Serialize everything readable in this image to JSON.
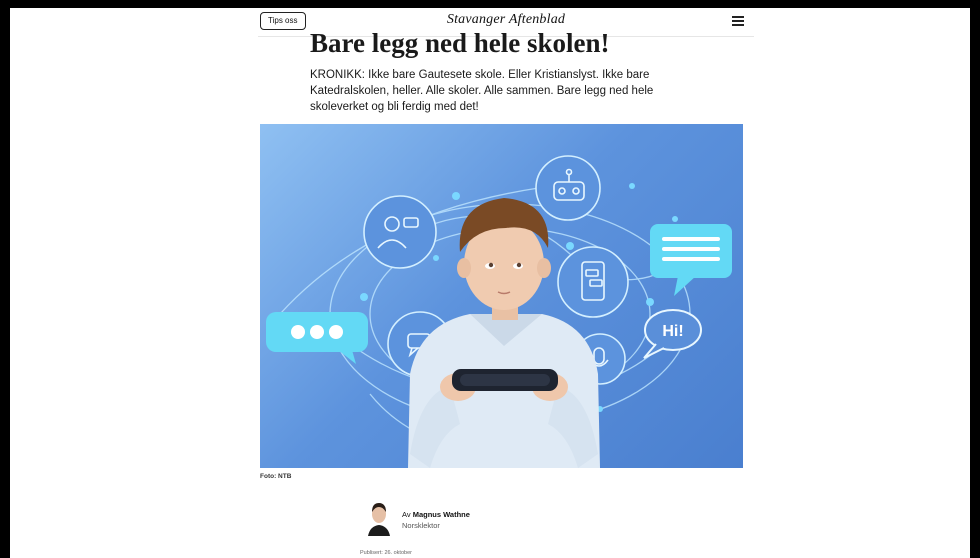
{
  "header": {
    "tips_label": "Tips oss",
    "logo_text": "Stavanger Aftenblad"
  },
  "article": {
    "headline": "Bare legg ned hele skolen!",
    "lead": "KRONIKK: Ikke bare Gautesete skole. Eller Kristianslyst. Ikke bare Katedralskolen, heller. Alle skoler. Alle sammen. Bare legg ned hele skoleverket og bli ferdig med det!",
    "image": {
      "bubble_left_text": "•••",
      "bubble_right_text": "Hi!",
      "caption": "Foto: NTB"
    },
    "byline": {
      "prefix": "Av",
      "author": "Magnus Wathne",
      "role": "Norsklektor"
    },
    "published": "Publisert: 26. oktober"
  },
  "colors": {
    "image_bg_light": "#8fc0f2",
    "image_bg_dark": "#4a7fcf",
    "bubble_cyan": "#5fd6f2"
  },
  "icons": [
    "menu-icon",
    "robot-icon",
    "person-chat-icon",
    "phone-chat-icon",
    "chat-bubble-icon",
    "microphone-icon"
  ]
}
